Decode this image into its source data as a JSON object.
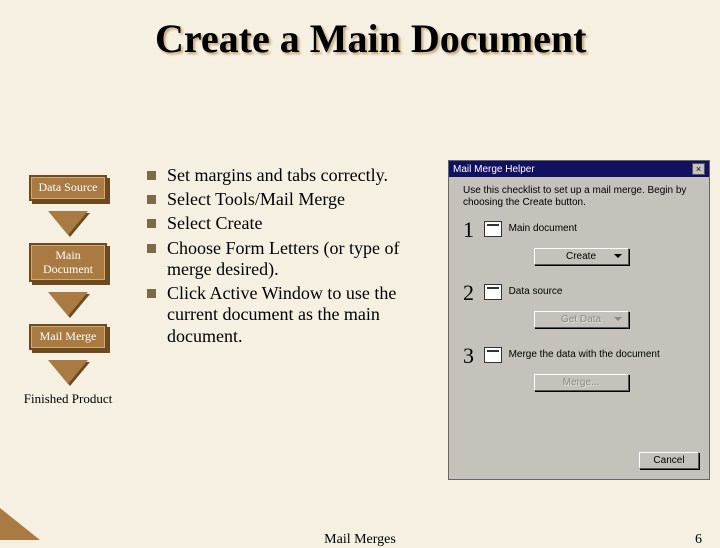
{
  "title": "Create a Main Document",
  "sidebar": {
    "items": [
      {
        "label": "Data Source"
      },
      {
        "label": "Main Document"
      },
      {
        "label": "Mail Merge"
      },
      {
        "label": "Finished Product"
      }
    ]
  },
  "bullets": [
    "Set margins and tabs correctly.",
    "Select Tools/Mail Merge",
    "Select Create",
    "Choose Form Letters (or type of merge desired).",
    "Click Active Window to use the current document as the main document."
  ],
  "dialog": {
    "title": "Mail Merge Helper",
    "instruction": "Use this checklist to set up a mail merge. Begin by choosing the Create button.",
    "steps": [
      {
        "num": "1",
        "label": "Main document",
        "button": "Create",
        "enabled": true
      },
      {
        "num": "2",
        "label": "Data source",
        "button": "Get Data",
        "enabled": false
      },
      {
        "num": "3",
        "label": "Merge the data with the document",
        "button": "Merge...",
        "enabled": false
      }
    ],
    "cancel": "Cancel",
    "close": "×"
  },
  "footer": {
    "center": "Mail Merges",
    "page": "6"
  }
}
